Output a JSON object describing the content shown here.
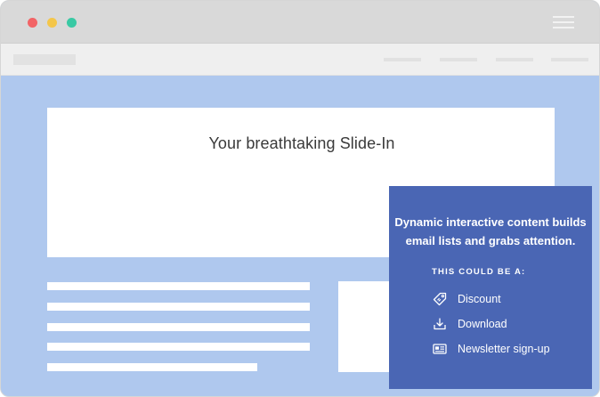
{
  "window": {
    "controls": [
      "close",
      "minimize",
      "maximize"
    ],
    "colors": {
      "close": "#f26466",
      "minimize": "#f4c64a",
      "maximize": "#39c9a4",
      "page_background": "#afc8ee",
      "slide_in_background": "#4a66b4"
    }
  },
  "hero": {
    "title": "Your breathtaking Slide-In"
  },
  "slide_in": {
    "headline_line1": "Dynamic interactive content builds",
    "headline_line2": "email lists and grabs attention.",
    "subheading": "THIS COULD BE A:",
    "options": [
      {
        "label": "Discount",
        "icon": "tag-icon"
      },
      {
        "label": "Download",
        "icon": "download-icon"
      },
      {
        "label": "Newsletter sign-up",
        "icon": "newsletter-icon"
      }
    ]
  }
}
